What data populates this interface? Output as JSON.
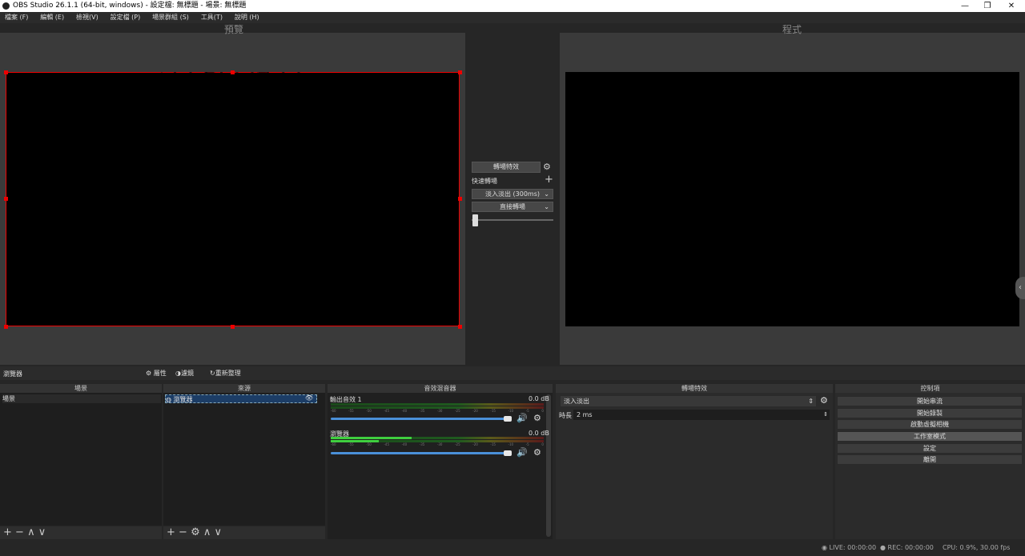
{
  "window": {
    "title": "OBS Studio 26.1.1 (64-bit, windows) - 設定檔: 無標題 - 場景: 無標題",
    "minimize": "—",
    "restore": "❐",
    "close": "✕"
  },
  "menu": [
    "檔案 (F)",
    "編輯 (E)",
    "檢視(V)",
    "設定檔 (P)",
    "場景群組 (S)",
    "工具(T)",
    "說明 (H)"
  ],
  "preview": {
    "label": "預覽"
  },
  "program": {
    "label": "程式"
  },
  "transition_center": {
    "button": "轉場特效",
    "quick_label": "快速轉場",
    "fade": "淡入淡出 (300ms)",
    "cut": "直接轉場"
  },
  "source_bar": {
    "selected": "瀏覽器",
    "properties": "屬性",
    "filters": "濾鏡",
    "refresh": "重新整理"
  },
  "docks": {
    "scenes": {
      "title": "場景",
      "items": [
        "場景"
      ]
    },
    "sources": {
      "title": "來源",
      "items": [
        "瀏覽器"
      ]
    },
    "mixer": {
      "title": "音效混音器",
      "channels": [
        {
          "name": "輸出音效 1",
          "db": "0.0 dB",
          "level": 0.0
        },
        {
          "name": "瀏覽器",
          "db": "0.0 dB",
          "level": 0.38
        }
      ],
      "ticks": [
        "-60",
        "-55",
        "-50",
        "-45",
        "-40",
        "-35",
        "-30",
        "-25",
        "-20",
        "-15",
        "-10",
        "-5",
        "0"
      ]
    },
    "transitions": {
      "title": "轉場特效",
      "selected": "淡入淡出",
      "duration_label": "時長",
      "duration": "2 ms"
    },
    "controls": {
      "title": "控制項",
      "buttons": [
        "開始串流",
        "開始錄製",
        "啟動虛擬相機",
        "工作室模式",
        "設定",
        "離開"
      ]
    }
  },
  "status": {
    "live": "LIVE: 00:00:00",
    "rec": "REC: 00:00:00",
    "cpu": "CPU: 0.9%, 30.00 fps"
  },
  "colors": {
    "accent": "#e00000",
    "mixer_slider": "#4a90d9",
    "meter_green": "#3fcf3f"
  }
}
